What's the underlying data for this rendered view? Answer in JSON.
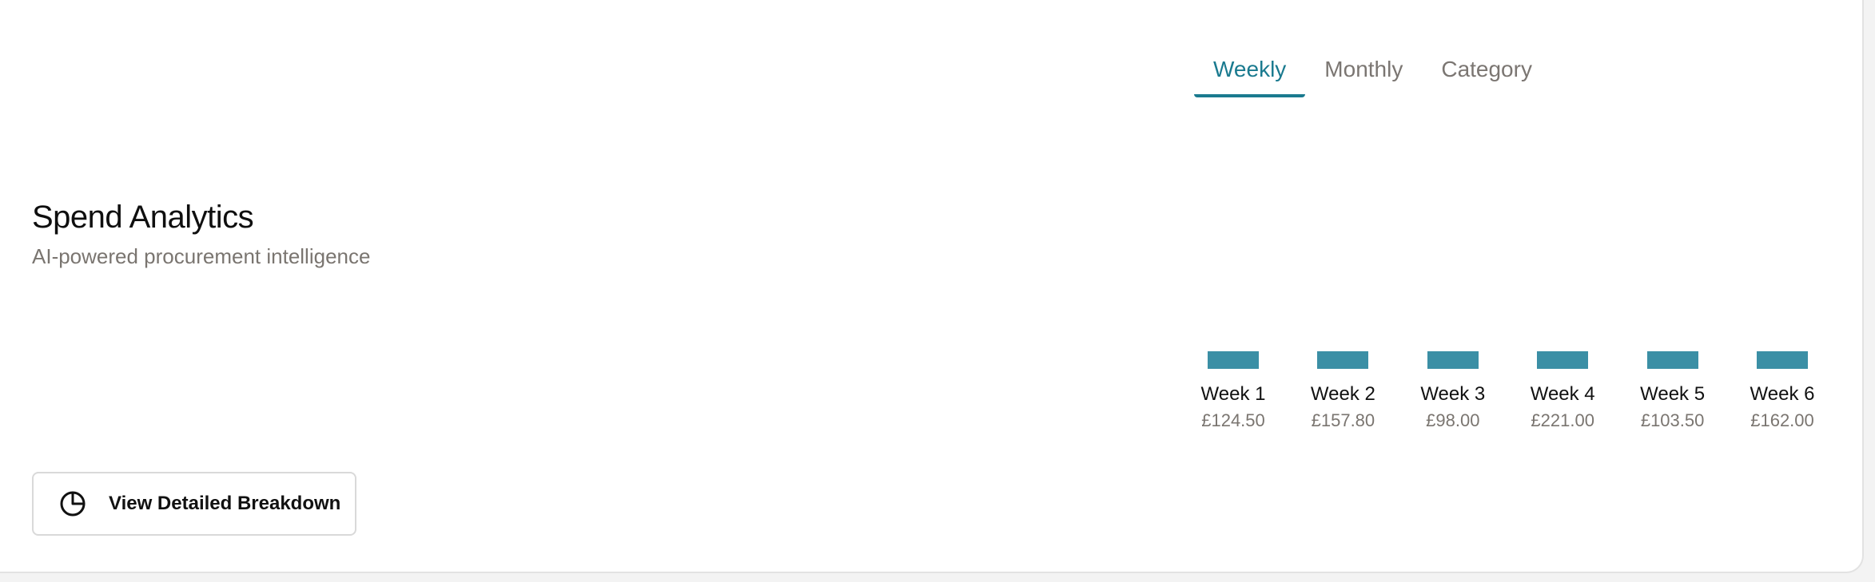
{
  "header": {
    "title": "Spend Analytics",
    "subtitle": "AI-powered procurement intelligence"
  },
  "tabs": [
    {
      "label": "Weekly",
      "active": true
    },
    {
      "label": "Monthly",
      "active": false
    },
    {
      "label": "Category",
      "active": false
    }
  ],
  "colors": {
    "accent": "#1a7a8f",
    "bar": "#3b8fa5"
  },
  "chart_data": {
    "type": "bar",
    "categories": [
      "Week 1",
      "Week 2",
      "Week 3",
      "Week 4",
      "Week 5",
      "Week 6"
    ],
    "value_labels": [
      "£124.50",
      "£157.80",
      "£98.00",
      "£221.00",
      "£103.50",
      "£162.00"
    ],
    "values": [
      124.5,
      157.8,
      98.0,
      221.0,
      103.5,
      162.0
    ],
    "title": "",
    "xlabel": "",
    "ylabel": ""
  },
  "actions": {
    "detail_button_label": "View Detailed Breakdown",
    "detail_button_icon": "pie-chart-icon"
  }
}
